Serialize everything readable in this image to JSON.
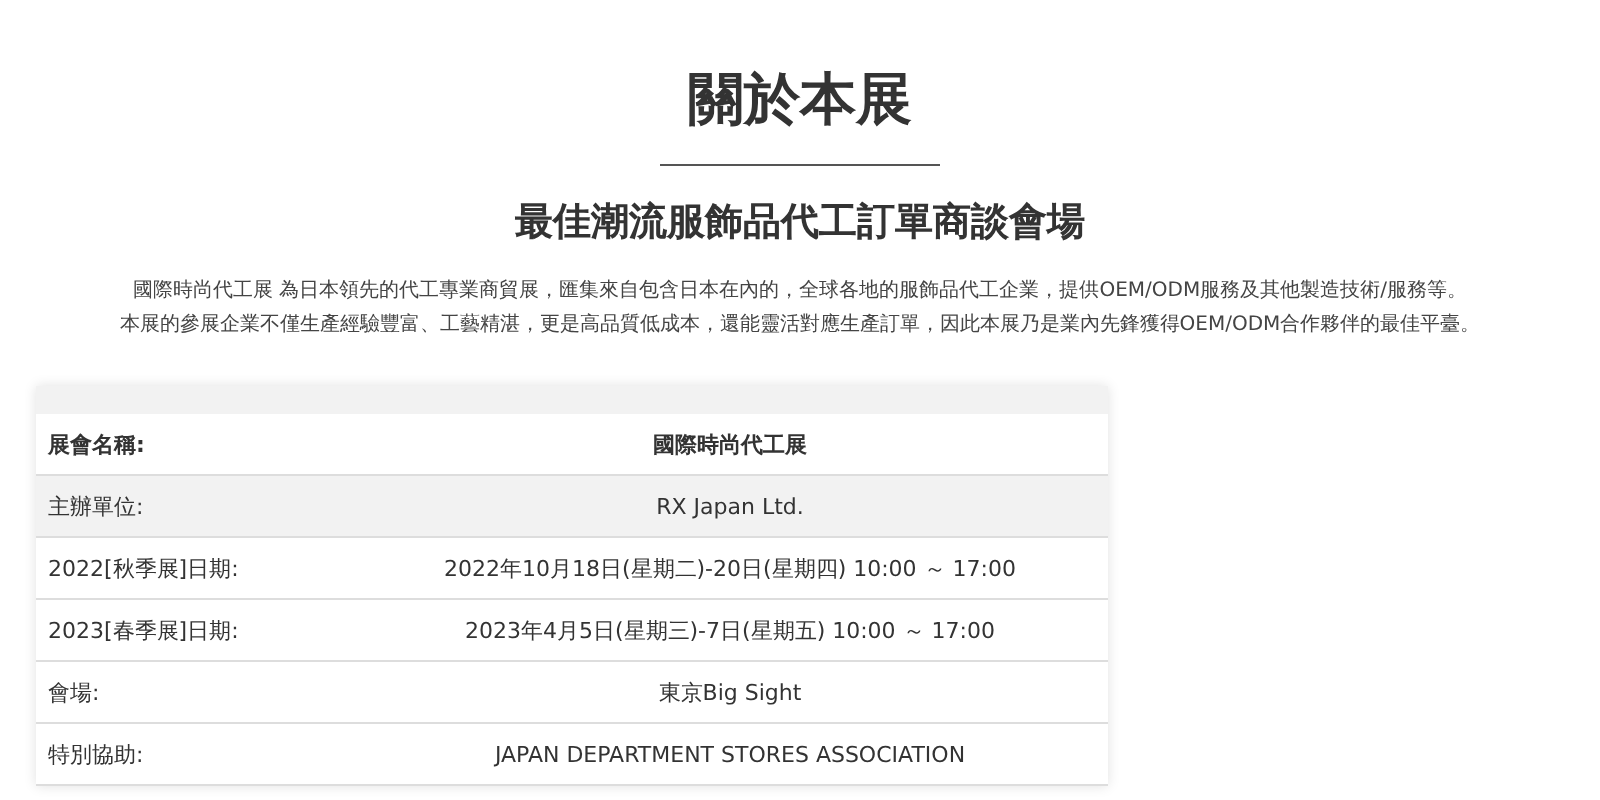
{
  "title": "關於本展",
  "subtitle": "最佳潮流服飾品代工訂單商談會場",
  "intro": [
    "國際時尚代工展 為日本領先的代工專業商貿展，匯集來自包含日本在內的，全球各地的服飾品代工企業，提供OEM/ODM服務及其他製造技術/服務等。",
    "本展的參展企業不僅生產經驗豐富、工藝精湛，更是高品質低成本，還能靈活對應生產訂單，因此本展乃是業內先鋒獲得OEM/ODM合作夥伴的最佳平臺。"
  ],
  "table": {
    "rows": [
      {
        "kind": "header",
        "label": "展會名稱:",
        "value": "國際時尚代工展",
        "shaded": false
      },
      {
        "kind": "data",
        "label": "主辦單位:",
        "value": "RX Japan Ltd.",
        "shaded": true
      },
      {
        "kind": "data",
        "label": "2022[秋季展]日期:",
        "value": "2022年10月18日(星期二)-20日(星期四) 10:00 ～ 17:00",
        "shaded": false
      },
      {
        "kind": "data",
        "label": "2023[春季展]日期:",
        "value": "2023年4月5日(星期三)-7日(星期五) 10:00 ～ 17:00",
        "shaded": false
      },
      {
        "kind": "data",
        "label": "會場:",
        "value": "東京Big Sight",
        "shaded": false
      },
      {
        "kind": "data",
        "label": "特別協助:",
        "value": "JAPAN DEPARTMENT STORES ASSOCIATION",
        "shaded": false
      }
    ]
  }
}
